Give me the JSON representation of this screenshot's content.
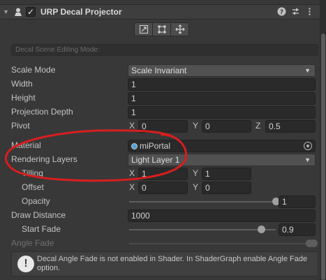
{
  "component": {
    "title": "URP Decal Projector",
    "enabled_check": "✓"
  },
  "header_buttons": {
    "help": "?",
    "presets": "⇄",
    "menu": "⋮"
  },
  "tools": [
    "scale-icon",
    "crop-icon",
    "move-icon"
  ],
  "mode_field": {
    "value": "Decal Scene Editing Mode:"
  },
  "properties": {
    "scale_mode": {
      "label": "Scale Mode",
      "value": "Scale Invariant"
    },
    "width": {
      "label": "Width",
      "value": "1"
    },
    "height": {
      "label": "Height",
      "value": "1"
    },
    "projection_depth": {
      "label": "Projection Depth",
      "value": "1"
    },
    "pivot": {
      "label": "Pivot",
      "x_label": "X",
      "x": "0",
      "y_label": "Y",
      "y": "0",
      "z_label": "Z",
      "z": "0.5"
    },
    "material": {
      "label": "Material",
      "value": "miPortal"
    },
    "rendering_layers": {
      "label": "Rendering Layers",
      "value": "Light Layer 1"
    },
    "tilling": {
      "label": "Tilling",
      "x_label": "X",
      "x": "1",
      "y_label": "Y",
      "y": "1"
    },
    "offset": {
      "label": "Offset",
      "x_label": "X",
      "x": "0",
      "y_label": "Y",
      "y": "0"
    },
    "opacity": {
      "label": "Opacity",
      "value": "1",
      "slider_fraction": 1.0
    },
    "draw_distance": {
      "label": "Draw Distance",
      "value": "1000"
    },
    "start_fade": {
      "label": "Start Fade",
      "value": "0.9",
      "slider_fraction": 0.9
    },
    "angle_fade": {
      "label": "Angle Fade"
    }
  },
  "info": {
    "icon": "!",
    "text": "Decal Angle Fade is not enabled in Shader. In ShaderGraph enable Angle Fade option."
  },
  "colors": {
    "background": "#383838",
    "annotation": "#d81e1e",
    "field": "#2a2a2a",
    "dropdown": "#515151"
  }
}
